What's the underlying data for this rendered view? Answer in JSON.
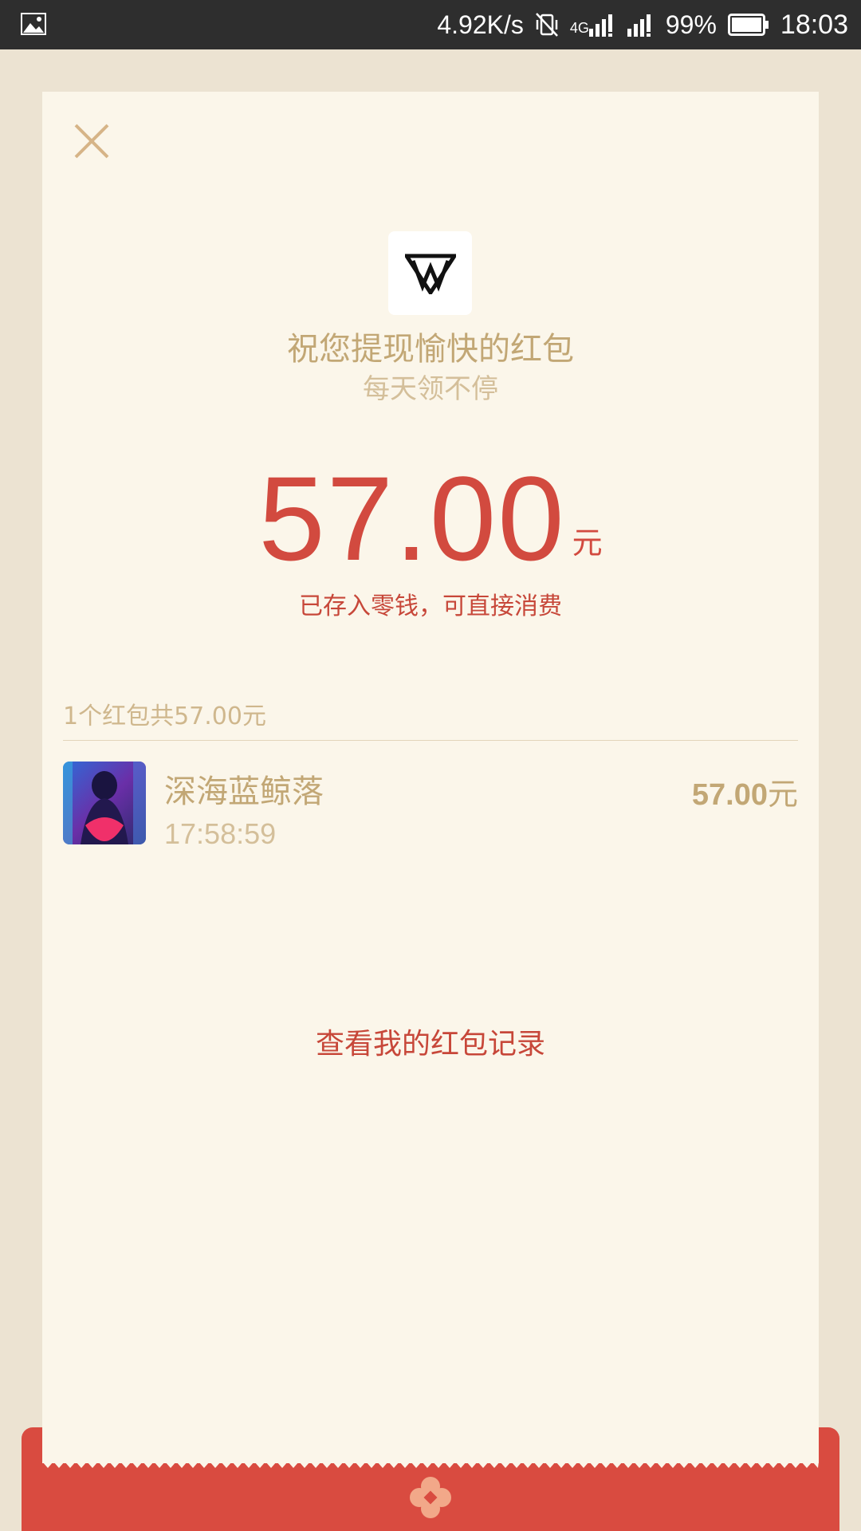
{
  "status_bar": {
    "speed": "4.92K/s",
    "network": "4G",
    "battery": "99%",
    "time": "18:03",
    "icons": [
      "gallery-icon",
      "vibrate-off-icon",
      "signal-4g-icon",
      "signal-icon",
      "battery-icon"
    ]
  },
  "card": {
    "greeting": "祝您提现愉快的红包",
    "subgreeting": "每天领不停",
    "amount": "57.00",
    "amount_unit": "元",
    "stored_note": "已存入零钱，可直接消费",
    "summary": "1个红包共57.00元",
    "sender": {
      "name": "深海蓝鲸落",
      "time": "17:58:59",
      "amount": "57.00",
      "unit": "元"
    },
    "records_link": "查看我的红包记录"
  },
  "colors": {
    "accent_red": "#d24a3f",
    "gold": "#c2a775",
    "card_bg": "#fbf6ea",
    "page_bg": "#ece3d2",
    "envelope_red": "#d94b40"
  }
}
